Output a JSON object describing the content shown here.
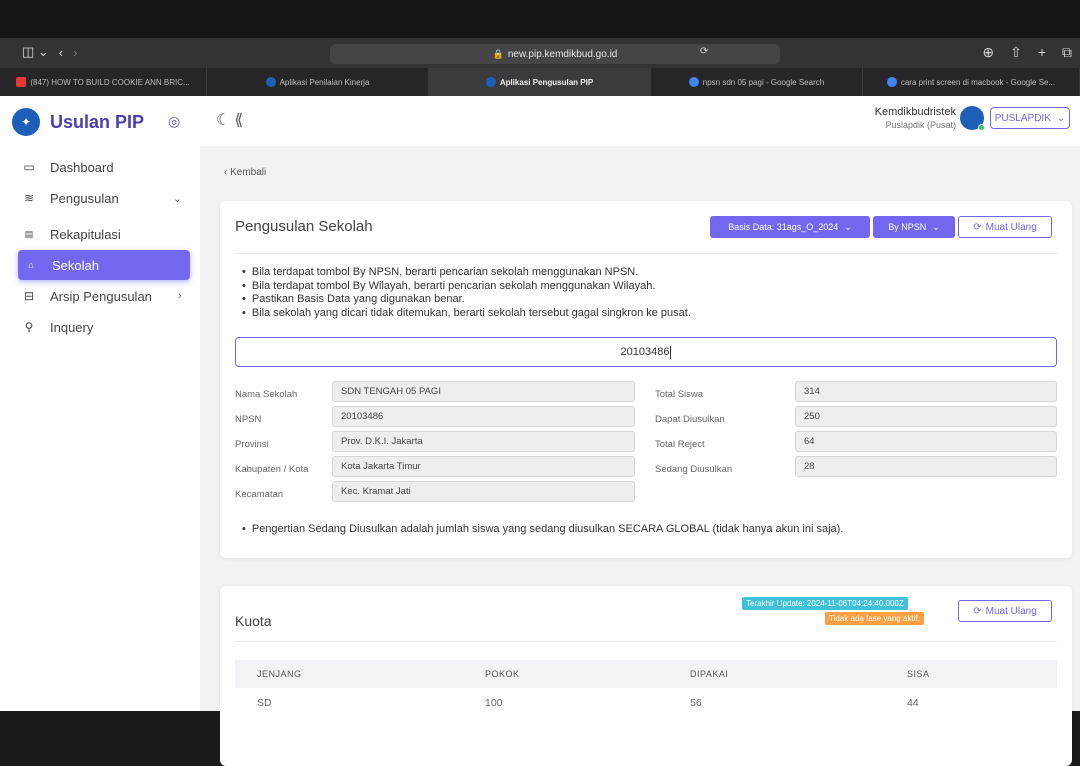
{
  "browser": {
    "url": "new.pip.kemdikbud.go.id",
    "tabs": [
      {
        "label": "(847) HOW TO BUILD COOKIE ANN BRIC...",
        "color": "#e53935"
      },
      {
        "label": "Aplikasi Penilaian Kinerja",
        "color": "#1d5fb8"
      },
      {
        "label": "Aplikasi Pengusulan PIP",
        "color": "#1d5fb8",
        "active": true
      },
      {
        "label": "npsn sdn 05 pagi - Google Search",
        "color": "#4285f4"
      },
      {
        "label": "cara print screen di macbook - Google Se...",
        "color": "#4285f4"
      }
    ]
  },
  "sidebar": {
    "app_name": "Usulan PIP",
    "items": [
      {
        "label": "Dashboard",
        "icon": "monitor-icon"
      },
      {
        "label": "Pengusulan",
        "icon": "layers-icon"
      },
      {
        "label": "Rekapitulasi",
        "icon": "table-icon"
      },
      {
        "label": "Sekolah",
        "icon": "home-icon"
      },
      {
        "label": "Arsip Pengusulan",
        "icon": "archive-icon"
      },
      {
        "label": "Inquery",
        "icon": "search-icon"
      }
    ]
  },
  "header": {
    "user_name": "Kemdikbudristek",
    "user_role": "Puslapdik (Pusat)",
    "role_button": "PUSLAPDIK"
  },
  "content": {
    "back_label": "Kembali",
    "card_title": "Pengusulan Sekolah",
    "basis_data": "Basis Data: 31ags_O_2024",
    "search_mode": "By NPSN",
    "reload_label": "Muat Ulang",
    "notes": [
      "Bila terdapat tombol By NPSN, berarti pencarian sekolah menggunakan NPSN.",
      "Bila terdapat tombol By Wilayah, berarti pencarian sekolah menggunakan Wilayah.",
      "Pastikan Basis Data yang digunakan benar.",
      "Bila sekolah yang dicari tidak ditemukan, berarti sekolah tersebut gagal singkron ke pusat."
    ],
    "search_value": "20103486",
    "school": {
      "nama_label": "Nama Sekolah",
      "nama": "SDN TENGAH 05 PAGI",
      "npsn_label": "NPSN",
      "npsn": "20103486",
      "provinsi_label": "Provinsi",
      "provinsi": "Prov. D.K.I. Jakarta",
      "kab_label": "Kabupaten / Kota",
      "kab": "Kota Jakarta Timur",
      "kec_label": "Kecamatan",
      "kec": "Kec. Kramat Jati"
    },
    "stats": {
      "total_label": "Total Siswa",
      "total": "314",
      "dapat_label": "Dapat Diusulkan",
      "dapat": "250",
      "reject_label": "Total Reject",
      "reject": "64",
      "sedang_label": "Sedang Diusulkan",
      "sedang": "28"
    },
    "note2": "Pengertian Sedang Diusulkan adalah jumlah siswa yang sedang diusulkan SECARA GLOBAL (tidak hanya akun ini saja)."
  },
  "kuota": {
    "title": "Kuota",
    "last_update": "Terakhir Update: 2024-11-06T04:24:40.000Z",
    "phase_status": "Tidak ada fase yang aktif.",
    "reload_label": "Muat Ulang",
    "columns": [
      "JENJANG",
      "POKOK",
      "DIPAKAI",
      "SISA"
    ],
    "rows": [
      [
        "SD",
        "100",
        "56",
        "44"
      ]
    ]
  },
  "colors": {
    "accent": "#7367f0",
    "info": "#3fc1d9",
    "warning": "#ff9f43"
  }
}
